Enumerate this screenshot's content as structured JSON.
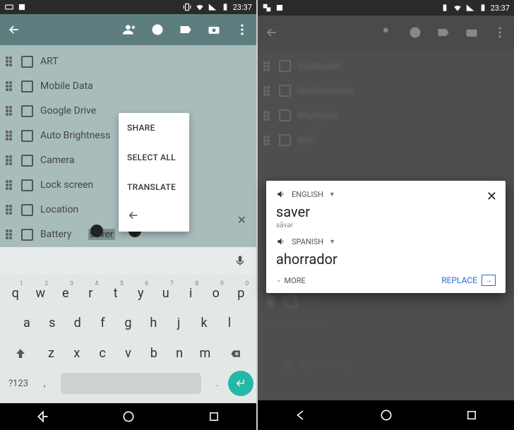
{
  "status": {
    "time": "23:37"
  },
  "left": {
    "items": [
      "ART",
      "Mobile Data",
      "Google Drive",
      "Auto Brightness",
      "Camera",
      "Lock screen",
      "Location",
      "Battery"
    ],
    "selected_suffix": "saver",
    "ctx": {
      "share": "SHARE",
      "select_all": "SELECT ALL",
      "translate": "TRANSLATE"
    },
    "keyboard": {
      "row1": [
        "q",
        "w",
        "e",
        "r",
        "t",
        "y",
        "u",
        "i",
        "o",
        "p"
      ],
      "nums": [
        "1",
        "2",
        "3",
        "4",
        "5",
        "6",
        "7",
        "8",
        "9",
        "0"
      ],
      "row2": [
        "a",
        "s",
        "d",
        "f",
        "g",
        "h",
        "j",
        "k",
        "l"
      ],
      "row3": [
        "z",
        "x",
        "c",
        "v",
        "b",
        "n",
        "m"
      ],
      "sym": "?123",
      "comma": ",",
      "period": "."
    }
  },
  "right": {
    "items": [
      "Keyboard",
      "Notifications",
      "Multitask",
      "ART"
    ],
    "add_item": "Edit item",
    "battery_row": "Battery",
    "remove": "Remove list",
    "translate": {
      "src_lang": "ENGLISH",
      "src_word": "saver",
      "src_translit": "sāvər",
      "dst_lang": "SPANISH",
      "dst_word": "ahorrador",
      "more": "MORE",
      "replace": "REPLACE"
    }
  }
}
